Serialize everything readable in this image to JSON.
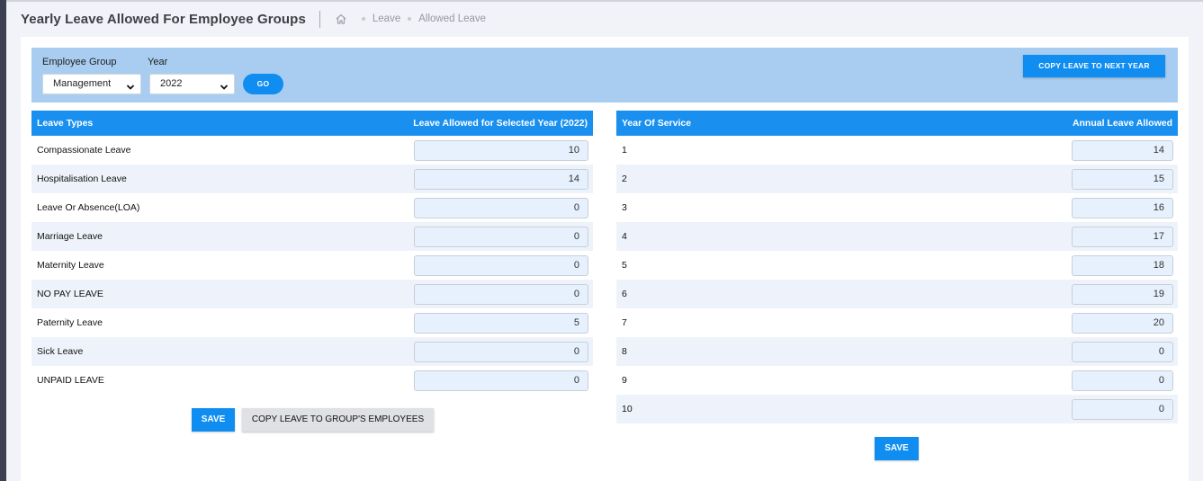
{
  "page": {
    "title": "Yearly Leave Allowed For Employee Groups",
    "breadcrumb": [
      "Leave",
      "Allowed Leave"
    ]
  },
  "filters": {
    "employee_group_label": "Employee Group",
    "employee_group_value": "Management",
    "year_label": "Year",
    "year_value": "2022",
    "go_label": "GO",
    "copy_next_year_label": "COPY LEAVE TO NEXT YEAR"
  },
  "leave_table": {
    "headers": [
      "Leave Types",
      "Leave Allowed for Selected Year (2022)"
    ],
    "rows": [
      {
        "type": "Compassionate Leave",
        "allowed": "10"
      },
      {
        "type": "Hospitalisation Leave",
        "allowed": "14"
      },
      {
        "type": "Leave Or Absence(LOA)",
        "allowed": "0"
      },
      {
        "type": "Marriage Leave",
        "allowed": "0"
      },
      {
        "type": "Maternity Leave",
        "allowed": "0"
      },
      {
        "type": "NO PAY LEAVE",
        "allowed": "0"
      },
      {
        "type": "Paternity Leave",
        "allowed": "5"
      },
      {
        "type": "Sick Leave",
        "allowed": "0"
      },
      {
        "type": "UNPAID LEAVE",
        "allowed": "0"
      }
    ],
    "save_label": "SAVE",
    "copy_group_label": "COPY LEAVE TO GROUP'S EMPLOYEES"
  },
  "service_table": {
    "headers": [
      "Year Of Service",
      "Annual Leave Allowed"
    ],
    "rows": [
      {
        "year": "1",
        "allowed": "14"
      },
      {
        "year": "2",
        "allowed": "15"
      },
      {
        "year": "3",
        "allowed": "16"
      },
      {
        "year": "4",
        "allowed": "17"
      },
      {
        "year": "5",
        "allowed": "18"
      },
      {
        "year": "6",
        "allowed": "19"
      },
      {
        "year": "7",
        "allowed": "20"
      },
      {
        "year": "8",
        "allowed": "0"
      },
      {
        "year": "9",
        "allowed": "0"
      },
      {
        "year": "10",
        "allowed": "0"
      }
    ],
    "save_label": "SAVE"
  },
  "icons": {
    "home": "home-icon",
    "dropdown": "chevron-down-icon"
  },
  "colors": {
    "primary": "#0f8df0",
    "table_header": "#1990f0",
    "filter_bar": "#a8cdf0",
    "input_bg": "#e6f1fd",
    "row_alt": "#eef3fb"
  }
}
